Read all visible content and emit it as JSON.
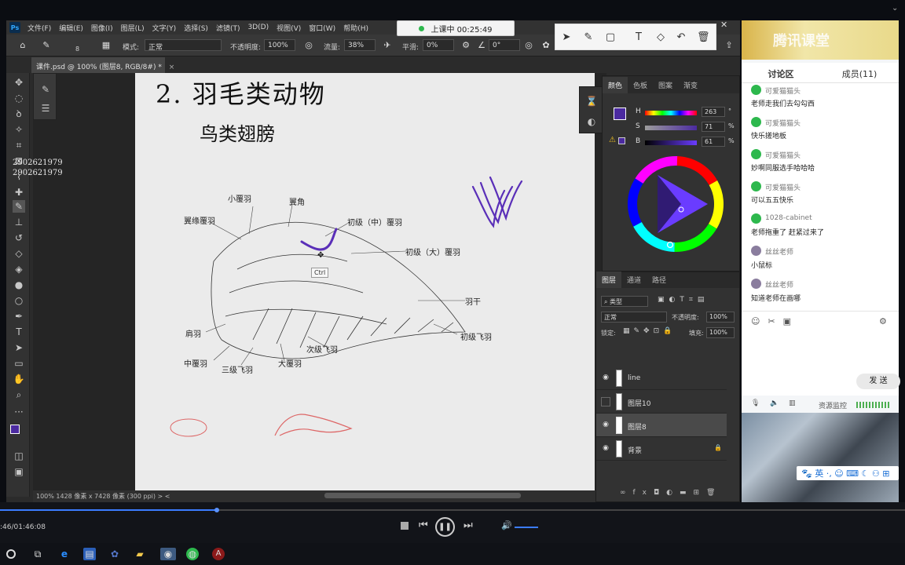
{
  "ps": {
    "logo": "Ps",
    "menu": [
      "文件(F)",
      "编辑(E)",
      "图像(I)",
      "图层(L)",
      "文字(Y)",
      "选择(S)",
      "滤镜(T)",
      "3D(D)",
      "视图(V)",
      "窗口(W)",
      "帮助(H)"
    ],
    "options": {
      "brush_size": "8",
      "mode_label": "模式:",
      "mode_value": "正常",
      "opacity_label": "不透明度:",
      "opacity_value": "100%",
      "flow_label": "流量:",
      "flow_value": "38%",
      "smooth_label": "平滑:",
      "smooth_value": "0%",
      "angle_value": "0°"
    },
    "doc_tab": "课件.psd @ 100% (图层8, RGB/8#) *",
    "watermark": [
      "2902621979",
      "2902621979"
    ],
    "status": "100%    1428 像素 x 7428 像素 (300 ppi)  >  <"
  },
  "canvas": {
    "heading": "2. 羽毛类动物",
    "subheading": "鸟类翅膀",
    "labels": [
      "小覆羽",
      "翼角",
      "翼缘覆羽",
      "初级（中）覆羽",
      "初级（大）覆羽",
      "羽干",
      "肩羽",
      "初级飞羽",
      "次级飞羽",
      "中覆羽",
      "三级飞羽",
      "大覆羽"
    ],
    "ctrl_tip": "Ctrl"
  },
  "color_panel": {
    "tabs": [
      "颜色",
      "色板",
      "图案",
      "渐变"
    ],
    "h_label": "H",
    "h_value": "263",
    "h_unit": "°",
    "s_label": "S",
    "s_value": "71",
    "s_unit": "%",
    "b_label": "B",
    "b_value": "61",
    "b_unit": "%",
    "swatch": "#4b2aa0"
  },
  "layers": {
    "tabs": [
      "图层",
      "通道",
      "路径"
    ],
    "filter": "类型",
    "blend": "正常",
    "opacity_label": "不透明度:",
    "opacity_value": "100%",
    "lock_label": "锁定:",
    "fill_label": "填充:",
    "fill_value": "100%",
    "items": [
      "line",
      "图层10",
      "图层8",
      "背景"
    ]
  },
  "class": {
    "recording": "上课中 00:25:49",
    "logo": "腾讯课堂",
    "tab_discuss": "讨论区",
    "tab_members": "成员(11)",
    "messages": [
      {
        "name": "可爱猫猫头",
        "text": "老师走我们去勾勾西",
        "teacher": false
      },
      {
        "name": "可爱猫猫头",
        "text": "快乐搓地板",
        "teacher": false
      },
      {
        "name": "可爱猫猫头",
        "text": "妙啊同服选手哈哈哈",
        "teacher": false
      },
      {
        "name": "可爱猫猫头",
        "text": "可以五五快乐",
        "teacher": false
      },
      {
        "name": "1028-cabinet",
        "text": "老师拖重了 赶紧过来了",
        "teacher": false
      },
      {
        "name": "丝丝老师",
        "text": "小鼠标",
        "teacher": true
      },
      {
        "name": "丝丝老师",
        "text": "知道老师在画哪",
        "teacher": true
      }
    ],
    "send": "发 送",
    "resource": "资源监控",
    "ime": "英"
  },
  "player": {
    "time": ":46/01:46:08",
    "progress": 0.24
  }
}
